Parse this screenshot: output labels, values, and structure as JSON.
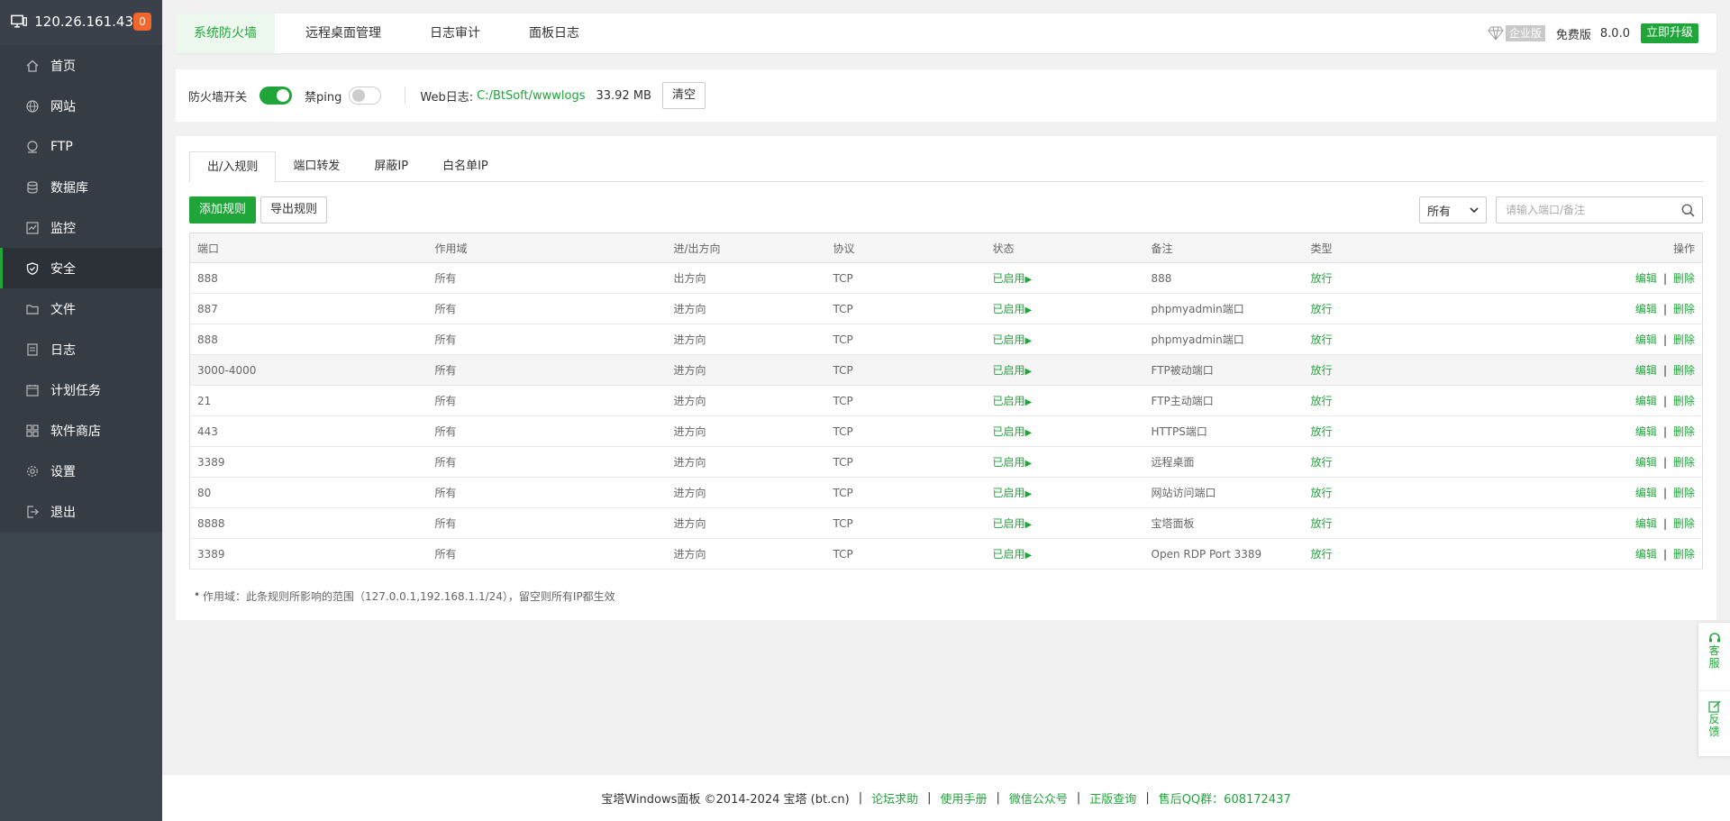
{
  "sidebar": {
    "ip": "120.26.161.43",
    "badge": "0",
    "items": [
      {
        "label": "首页",
        "icon": "home-icon"
      },
      {
        "label": "网站",
        "icon": "globe-icon"
      },
      {
        "label": "FTP",
        "icon": "ftp-icon"
      },
      {
        "label": "数据库",
        "icon": "database-icon"
      },
      {
        "label": "监控",
        "icon": "monitor-icon"
      },
      {
        "label": "安全",
        "icon": "shield-icon",
        "active": true
      },
      {
        "label": "文件",
        "icon": "folder-icon"
      },
      {
        "label": "日志",
        "icon": "log-icon"
      },
      {
        "label": "计划任务",
        "icon": "calendar-icon"
      },
      {
        "label": "软件商店",
        "icon": "grid-icon"
      },
      {
        "label": "设置",
        "icon": "gear-icon"
      },
      {
        "label": "退出",
        "icon": "logout-icon"
      }
    ]
  },
  "topbar": {
    "tabs": [
      "系统防火墙",
      "远程桌面管理",
      "日志审计",
      "面板日志"
    ],
    "enterprise": "企业版",
    "free": "免费版",
    "version": "8.0.0",
    "upgrade": "立即升级"
  },
  "switchbar": {
    "firewall_label": "防火墙开关",
    "ping_label": "禁ping",
    "weblog_label": "Web日志:",
    "weblog_path": "C:/BtSoft/wwwlogs",
    "weblog_size": "33.92 MB",
    "clear": "清空"
  },
  "panel": {
    "subtabs": [
      "出/入规则",
      "端口转发",
      "屏蔽IP",
      "白名单IP"
    ],
    "add_rule": "添加规则",
    "export_rule": "导出规则",
    "filter_value": "所有",
    "search_placeholder": "请输入端口/备注",
    "columns": [
      "端口",
      "作用域",
      "进/出方向",
      "协议",
      "状态",
      "备注",
      "类型",
      "操作"
    ],
    "rows": [
      [
        "888",
        "所有",
        "出方向",
        "TCP",
        "已启用",
        "888",
        "放行"
      ],
      [
        "887",
        "所有",
        "进方向",
        "TCP",
        "已启用",
        "phpmyadmin端口",
        "放行"
      ],
      [
        "888",
        "所有",
        "进方向",
        "TCP",
        "已启用",
        "phpmyadmin端口",
        "放行"
      ],
      [
        "3000-4000",
        "所有",
        "进方向",
        "TCP",
        "已启用",
        "FTP被动端口",
        "放行"
      ],
      [
        "21",
        "所有",
        "进方向",
        "TCP",
        "已启用",
        "FTP主动端口",
        "放行"
      ],
      [
        "443",
        "所有",
        "进方向",
        "TCP",
        "已启用",
        "HTTPS端口",
        "放行"
      ],
      [
        "3389",
        "所有",
        "进方向",
        "TCP",
        "已启用",
        "远程桌面",
        "放行"
      ],
      [
        "80",
        "所有",
        "进方向",
        "TCP",
        "已启用",
        "网站访问端口",
        "放行"
      ],
      [
        "8888",
        "所有",
        "进方向",
        "TCP",
        "已启用",
        "宝塔面板",
        "放行"
      ],
      [
        "3389",
        "所有",
        "进方向",
        "TCP",
        "已启用",
        "Open RDP Port 3389",
        "放行"
      ]
    ],
    "edit": "编辑",
    "delete": "删除",
    "op_sep": "|",
    "note": "作用域：此条规则所影响的范围（127.0.0.1,192.168.1.1/24），留空则所有IP都生效"
  },
  "footer": {
    "copyright": "宝塔Windows面板 ©2014-2024 宝塔 (bt.cn)",
    "links": [
      "论坛求助",
      "使用手册",
      "微信公众号",
      "正版查询",
      "售后QQ群：608172437"
    ]
  },
  "float": {
    "service": [
      "客",
      "服"
    ],
    "feedback": [
      "反",
      "馈"
    ]
  },
  "colors": {
    "accent": "#20a53a",
    "sidebar_bg": "#3c444d",
    "badge": "#f0662c"
  }
}
